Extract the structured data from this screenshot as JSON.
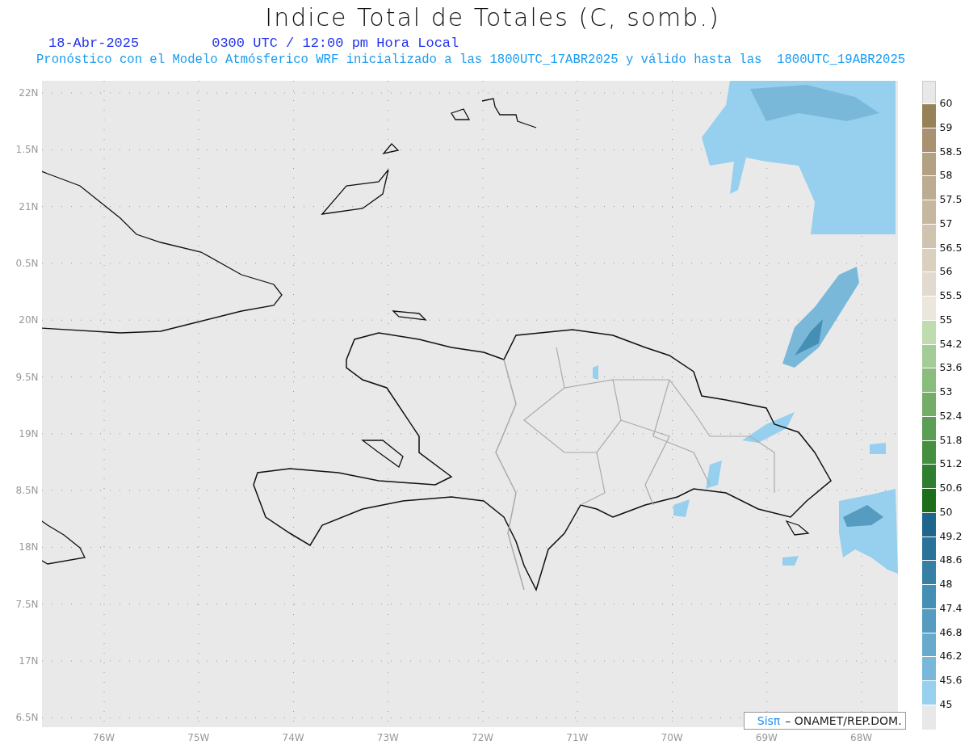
{
  "title": "Indice Total de Totales (C, somb.)",
  "date": "18-Abr-2025",
  "time": "0300 UTC / 12:00 pm Hora Local",
  "subtitle": "Pronóstico con el Modelo Atmósferico WRF inicializado a las 1800UTC_17ABR2025 y válido hasta las  1800UTC_19ABR2025",
  "y_axis": [
    "22N",
    "1.5N",
    "21N",
    "0.5N",
    "20N",
    "9.5N",
    "19N",
    "8.5N",
    "18N",
    "7.5N",
    "17N",
    "6.5N"
  ],
  "x_axis": [
    "76W",
    "75W",
    "74W",
    "73W",
    "72W",
    "71W",
    "70W",
    "69W",
    "68W"
  ],
  "credit": {
    "logo": "Sisπ",
    "text": "– ONAMET/REP.DOM."
  },
  "legend": [
    {
      "label": "60",
      "color": "#978159"
    },
    {
      "label": "59",
      "color": "#a99172"
    },
    {
      "label": "58.5",
      "color": "#b2a182"
    },
    {
      "label": "58",
      "color": "#bcac91"
    },
    {
      "label": "57.5",
      "color": "#c6b8a0"
    },
    {
      "label": "57",
      "color": "#d0c4b0"
    },
    {
      "label": "56.5",
      "color": "#dad0c0"
    },
    {
      "label": "56",
      "color": "#e2dace"
    },
    {
      "label": "55.5",
      "color": "#ebe7dd"
    },
    {
      "label": "55",
      "color": "#bedcb0"
    },
    {
      "label": "54.2",
      "color": "#a4cc96"
    },
    {
      "label": "53.6",
      "color": "#8abc7c"
    },
    {
      "label": "53",
      "color": "#74ac68"
    },
    {
      "label": "52.4",
      "color": "#5c9e54"
    },
    {
      "label": "51.8",
      "color": "#468e42"
    },
    {
      "label": "51.2",
      "color": "#307e30"
    },
    {
      "label": "50.6",
      "color": "#1c6e1c"
    },
    {
      "label": "50",
      "color": "#1e668c"
    },
    {
      "label": "49.2",
      "color": "#2a7298"
    },
    {
      "label": "48.6",
      "color": "#3680a6"
    },
    {
      "label": "48",
      "color": "#458eb4"
    },
    {
      "label": "47.4",
      "color": "#569cc0"
    },
    {
      "label": "46.8",
      "color": "#68aacc"
    },
    {
      "label": "46.2",
      "color": "#7ab8da"
    },
    {
      "label": "45.6",
      "color": "#96d0ee"
    },
    {
      "label": "45",
      "color": "#e8e8e8"
    }
  ]
}
